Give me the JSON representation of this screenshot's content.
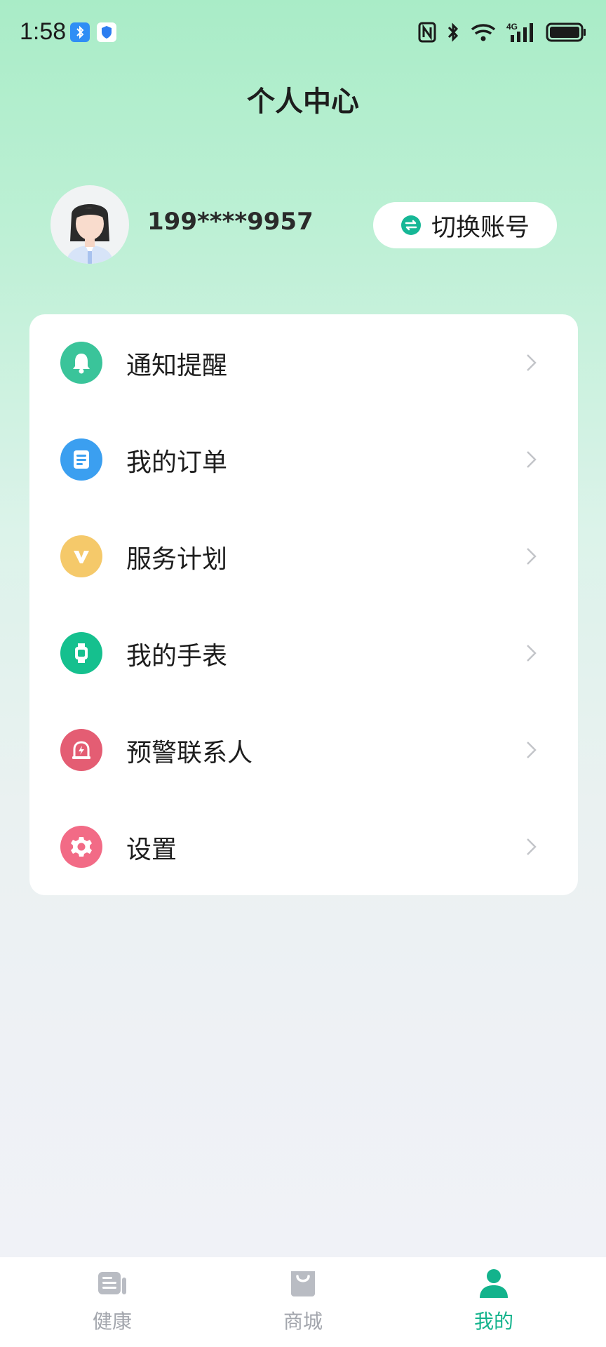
{
  "status_bar": {
    "time": "1:58",
    "icons": [
      "bluetooth-app-icon",
      "shield-app-icon",
      "nfc-icon",
      "bluetooth-icon",
      "wifi-icon",
      "signal-4g-icon",
      "battery-icon"
    ]
  },
  "header": {
    "title": "个人中心"
  },
  "profile": {
    "phone": "199****9957",
    "switch_account_label": "切换账号"
  },
  "menu": {
    "items": [
      {
        "label": "通知提醒",
        "icon": "bell-icon",
        "color": "#3ac49a"
      },
      {
        "label": "我的订单",
        "icon": "order-icon",
        "color": "#3b9ff0"
      },
      {
        "label": "服务计划",
        "icon": "vip-icon",
        "color": "#f5c96a"
      },
      {
        "label": "我的手表",
        "icon": "watch-icon",
        "color": "#15c08e"
      },
      {
        "label": "预警联系人",
        "icon": "alarm-icon",
        "color": "#e45d73"
      },
      {
        "label": "设置",
        "icon": "gear-icon",
        "color": "#f26b86"
      }
    ]
  },
  "tab_bar": {
    "tabs": [
      {
        "label": "健康",
        "icon": "health-news-icon",
        "active": false
      },
      {
        "label": "商城",
        "icon": "shopping-bag-icon",
        "active": false
      },
      {
        "label": "我的",
        "icon": "user-icon",
        "active": true
      }
    ],
    "active_color": "#13b38c",
    "inactive_color": "#a3a6ad"
  }
}
